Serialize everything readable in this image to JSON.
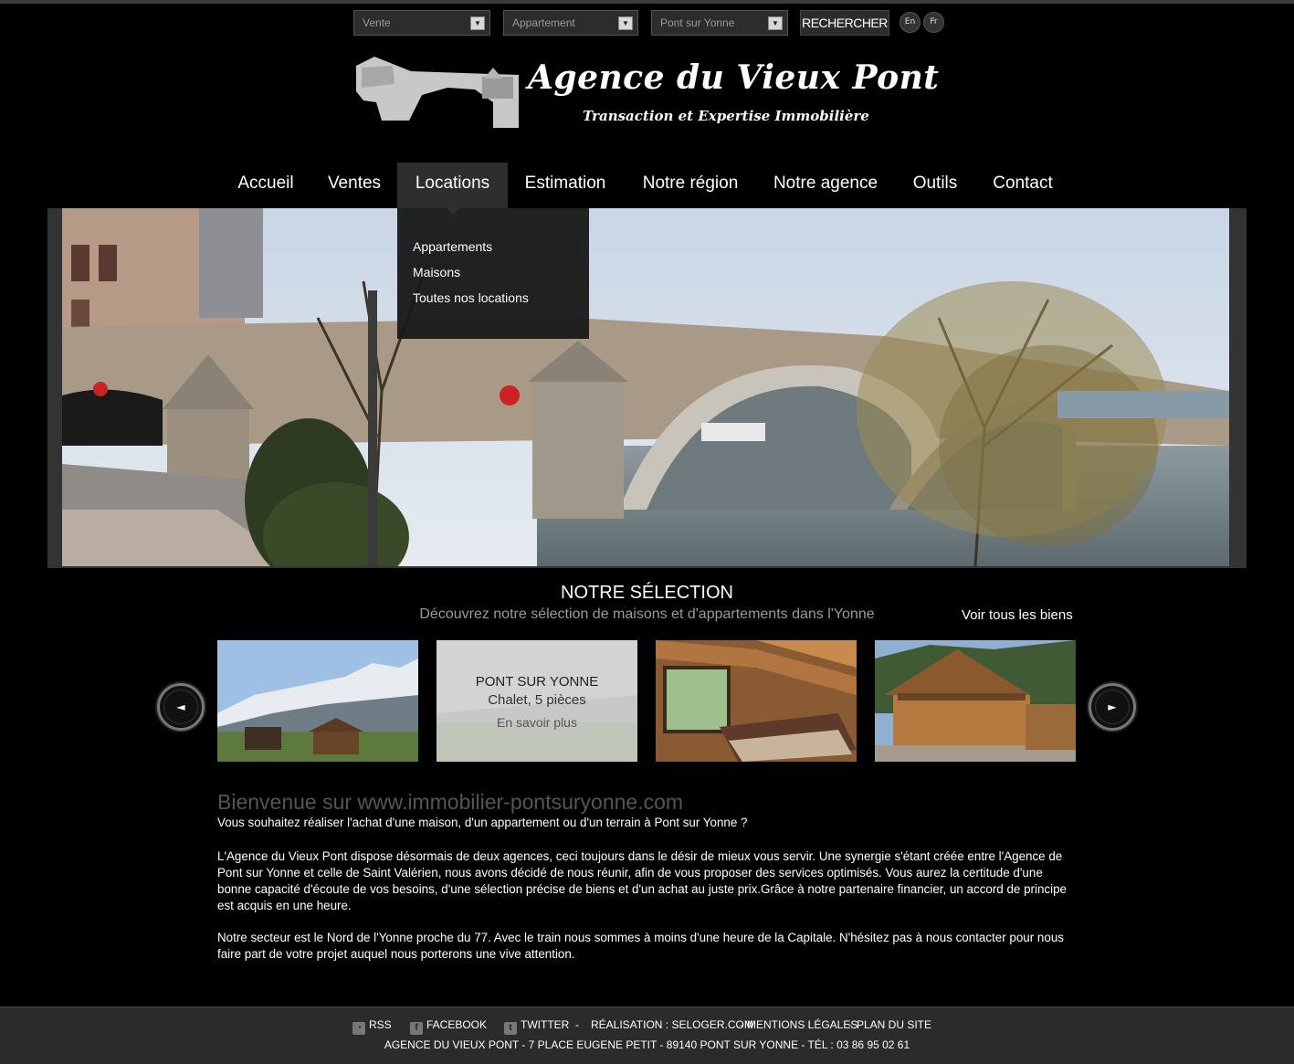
{
  "search": {
    "transaction": "Vente",
    "property_type": "Appartement",
    "location": "Pont sur Yonne",
    "button": "RECHERCHER"
  },
  "languages": [
    "En",
    "Fr"
  ],
  "logo": {
    "title": "Agence du Vieux Pont",
    "subtitle": "Transaction et Expertise Immobilière"
  },
  "nav": {
    "items": [
      "Accueil",
      "Ventes",
      "Locations",
      "Estimation",
      "Notre région",
      "Notre agence",
      "Outils",
      "Contact"
    ],
    "active": "Locations",
    "dropdown": [
      "Appartements",
      "Maisons",
      "Toutes nos locations"
    ]
  },
  "selection": {
    "title": "NOTRE SÉLECTION",
    "subtitle": "Découvrez notre sélection de maisons et d'appartements dans l'Yonne",
    "see_all": "Voir tous les biens",
    "hovered": {
      "town": "PONT SUR YONNE",
      "type": "Chalet, 5 pièces",
      "more": "En savoir plus"
    }
  },
  "welcome": {
    "title": "Bienvenue sur www.immobilier-pontsuryonne.com",
    "p1": "Vous souhaitez réaliser l'achat d'une maison, d'un appartement ou d'un terrain à Pont sur Yonne ?",
    "p2": "L'Agence du Vieux Pont dispose désormais de deux agences, ceci toujours dans le désir de mieux vous servir. Une synergie s'étant créée entre l'Agence de Pont sur Yonne et celle de Saint Valérien, nous avons décidé de nous réunir, afin de vous proposer des services optimisés. Vous aurez la certitude d'une bonne capacité d'écoute de vos besoins, d'une sélection précise de biens et d'un achat au juste prix.Grâce à notre partenaire financier, un accord de principe est acquis en une heure.",
    "p3": "Notre secteur est le Nord de l'Yonne proche du 77. Avec le train nous sommes à moins d'une heure de la Capitale. N'hésitez pas à nous contacter pour nous faire part de votre projet auquel nous porterons une vive attention."
  },
  "footer": {
    "rss": "RSS",
    "facebook": "FACEBOOK",
    "twitter": "TWITTER",
    "sep": "-",
    "realisation": "RÉALISATION : SELOGER.COM",
    "mentions": "MENTIONS LÉGALES",
    "plan": "PLAN DU SITE",
    "address": "AGENCE DU VIEUX PONT - 7 PLACE EUGENE PETIT - 89140 PONT SUR YONNE - TÉL : 03 86 95 02 61"
  }
}
